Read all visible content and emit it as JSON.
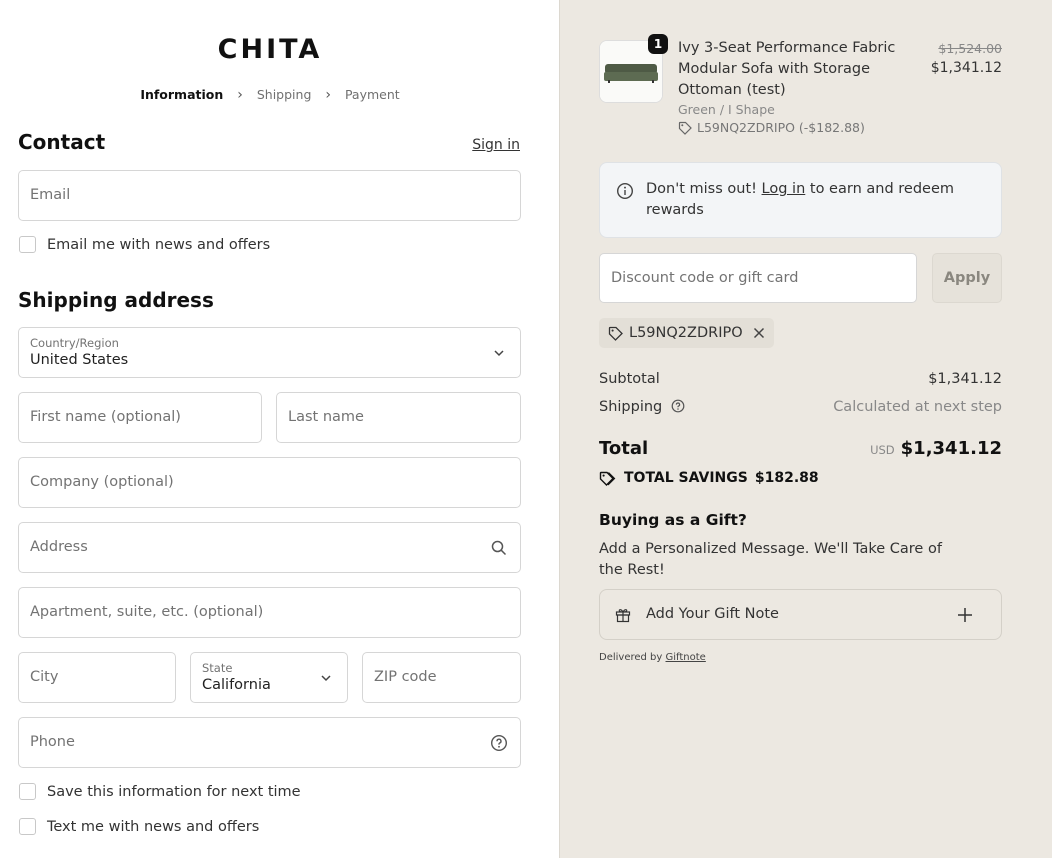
{
  "brand": {
    "logo": "CHITA"
  },
  "breadcrumb": {
    "step1": "Information",
    "step2": "Shipping",
    "step3": "Payment"
  },
  "contact": {
    "title": "Contact",
    "signin": "Sign in",
    "email_placeholder": "Email",
    "news_checkbox": "Email me with news and offers"
  },
  "shipping": {
    "title": "Shipping address",
    "country_label": "Country/Region",
    "country_value": "United States",
    "first_name": "First name (optional)",
    "last_name": "Last name",
    "company": "Company (optional)",
    "address": "Address",
    "apartment": "Apartment, suite, etc. (optional)",
    "city": "City",
    "state_label": "State",
    "state_value": "California",
    "zip": "ZIP code",
    "phone": "Phone",
    "save_info": "Save this information for next time",
    "text_news": "Text me with news and offers"
  },
  "order": {
    "item": {
      "quantity": "1",
      "name": "Ivy 3-Seat Performance Fabric Modular Sofa with Storage Ottoman (test)",
      "variant": "Green / I Shape",
      "discount_code": "L59NQ2ZDRIPO (-$182.88)",
      "original_price": "$1,524.00",
      "price": "$1,341.12"
    },
    "notice": {
      "prefix": "Don't miss out! ",
      "link": "Log in",
      "suffix": " to earn and redeem rewards"
    },
    "discount_placeholder": "Discount code or gift card",
    "apply": "Apply",
    "applied_code": "L59NQ2ZDRIPO",
    "subtotal_label": "Subtotal",
    "subtotal_value": "$1,341.12",
    "shipping_label": "Shipping",
    "shipping_value": "Calculated at next step",
    "total_label": "Total",
    "currency": "USD",
    "total_value": "$1,341.12",
    "savings_label": "TOTAL SAVINGS",
    "savings_value": "$182.88"
  },
  "gift": {
    "title": "Buying as a Gift?",
    "subtitle": "Add a Personalized Message. We'll Take Care of the Rest!",
    "note_button": "Add Your Gift Note",
    "delivered_prefix": "Delivered by ",
    "delivered_link": "Giftnote"
  },
  "colors": {
    "left_bg": "#ffffff",
    "right_bg": "#ece8e1",
    "accent": "#111111"
  }
}
